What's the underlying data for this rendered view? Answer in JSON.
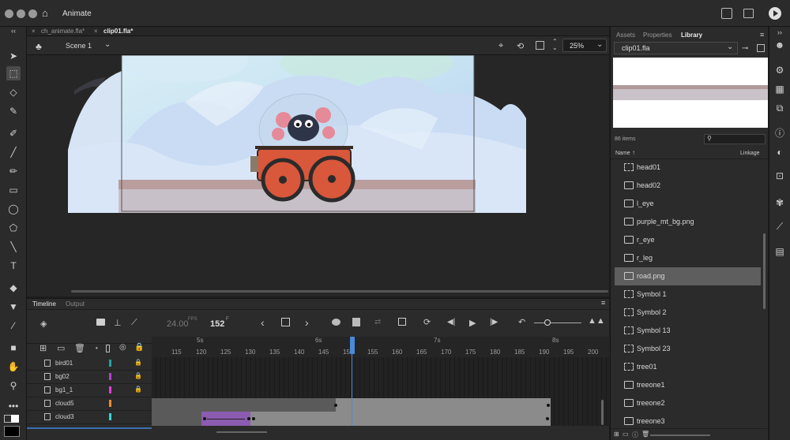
{
  "app": {
    "title": "Animate"
  },
  "document_tabs": [
    {
      "label": "ch_animate.fla*",
      "active": false
    },
    {
      "label": "clip01.fla*",
      "active": true
    }
  ],
  "scene": {
    "label": "Scene 1",
    "zoom": "25%"
  },
  "timeline": {
    "tabs": [
      "Timeline",
      "Output"
    ],
    "fps": "24.00",
    "fps_unit": "FPS",
    "frame": "152",
    "frame_unit": "F",
    "seconds_marks": [
      "5s",
      "6s",
      "7s",
      "8s"
    ],
    "ruler": [
      "115",
      "120",
      "125",
      "130",
      "135",
      "140",
      "145",
      "150",
      "155",
      "160",
      "165",
      "170",
      "175",
      "180",
      "185",
      "190",
      "195",
      "200"
    ],
    "playhead_frame": 152,
    "layers": [
      {
        "name": "bird01",
        "color": "#1fa5a5",
        "locked": true
      },
      {
        "name": "bg02",
        "color": "#b044c8",
        "locked": true
      },
      {
        "name": "bg1_1",
        "color": "#e83ad8",
        "locked": true
      },
      {
        "name": "cloud5",
        "color": "#f08a2a",
        "locked": false
      },
      {
        "name": "cloud3",
        "color": "#2ad8d8",
        "locked": false
      }
    ]
  },
  "panel": {
    "tabs": [
      "Assets",
      "Properties",
      "Library"
    ],
    "active_tab": "Library",
    "library_file": "clip01.fla",
    "item_count": "86 items",
    "search_placeholder": "",
    "col_name": "Name",
    "col_linkage": "Linkage",
    "items": [
      {
        "label": "head01",
        "type": "symbol"
      },
      {
        "label": "head02",
        "type": "bitmap"
      },
      {
        "label": "l_eye",
        "type": "bitmap"
      },
      {
        "label": "purple_mt_bg.png",
        "type": "bitmap"
      },
      {
        "label": "r_eye",
        "type": "bitmap"
      },
      {
        "label": "r_leg",
        "type": "bitmap"
      },
      {
        "label": "road.png",
        "type": "bitmap",
        "selected": true
      },
      {
        "label": "Symbol 1",
        "type": "symbol"
      },
      {
        "label": "Symbol 2",
        "type": "symbol"
      },
      {
        "label": "Symbol 13",
        "type": "symbol"
      },
      {
        "label": "Symbol 23",
        "type": "symbol"
      },
      {
        "label": "tree01",
        "type": "symbol"
      },
      {
        "label": "treeone1",
        "type": "bitmap"
      },
      {
        "label": "treeone2",
        "type": "bitmap"
      },
      {
        "label": "treeone3",
        "type": "bitmap"
      }
    ]
  }
}
